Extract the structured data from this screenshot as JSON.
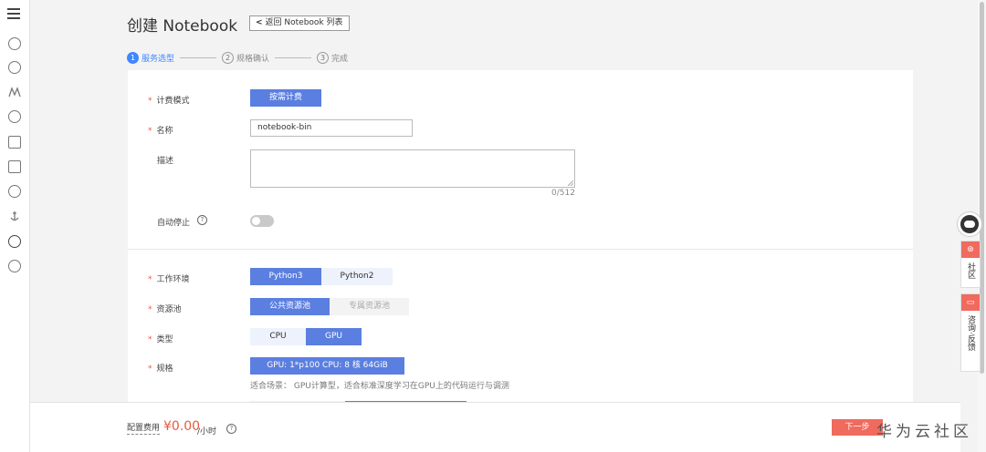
{
  "left_nav": {
    "icons": [
      "menu-icon",
      "cloud-icon",
      "cluster-icon",
      "chart-icon",
      "cloud-disk-icon",
      "cylinder-icon",
      "document-icon",
      "cloud-icon",
      "anchor-icon",
      "globe-icon",
      "circle-arrow-icon"
    ]
  },
  "header": {
    "title": "创建 Notebook",
    "back_label": "返回 Notebook 列表"
  },
  "steps": [
    {
      "num": "1",
      "label": "服务选型"
    },
    {
      "num": "2",
      "label": "规格确认"
    },
    {
      "num": "3",
      "label": "完成"
    }
  ],
  "form": {
    "billing_mode": {
      "label": "计费模式",
      "value": "按需计费"
    },
    "name": {
      "label": "名称",
      "value": "notebook-bin"
    },
    "description": {
      "label": "描述",
      "counter": "0/512"
    },
    "auto_stop": {
      "label": "自动停止",
      "enabled": false
    },
    "work_env": {
      "label": "工作环境",
      "options": [
        "Python3",
        "Python2"
      ],
      "selected": "Python3"
    },
    "resource_pool": {
      "label": "资源池",
      "options": [
        "公共资源池",
        "专属资源池"
      ],
      "selected": "公共资源池"
    },
    "type": {
      "label": "类型",
      "options": [
        "CPU",
        "GPU"
      ],
      "selected": "GPU"
    },
    "spec": {
      "label": "规格",
      "value": "GPU: 1*p100 CPU: 8 核 64GiB",
      "hint": "适合场景： GPU计算型，适合标准深度学习在GPU上的代码运行与调测"
    }
  },
  "footer": {
    "fee_label": "配置费用",
    "fee_amount": "¥0.00",
    "fee_unit": "/小时",
    "next_label": "下一步"
  },
  "right_float": {
    "community_label": "社区",
    "feedback_label": "咨询·反馈"
  },
  "watermark": "华为云社区",
  "colors": {
    "primary": "#5b7fe0",
    "step_active": "#3f86ff",
    "required": "#e85a3c",
    "next_button": "#f06a5e"
  }
}
